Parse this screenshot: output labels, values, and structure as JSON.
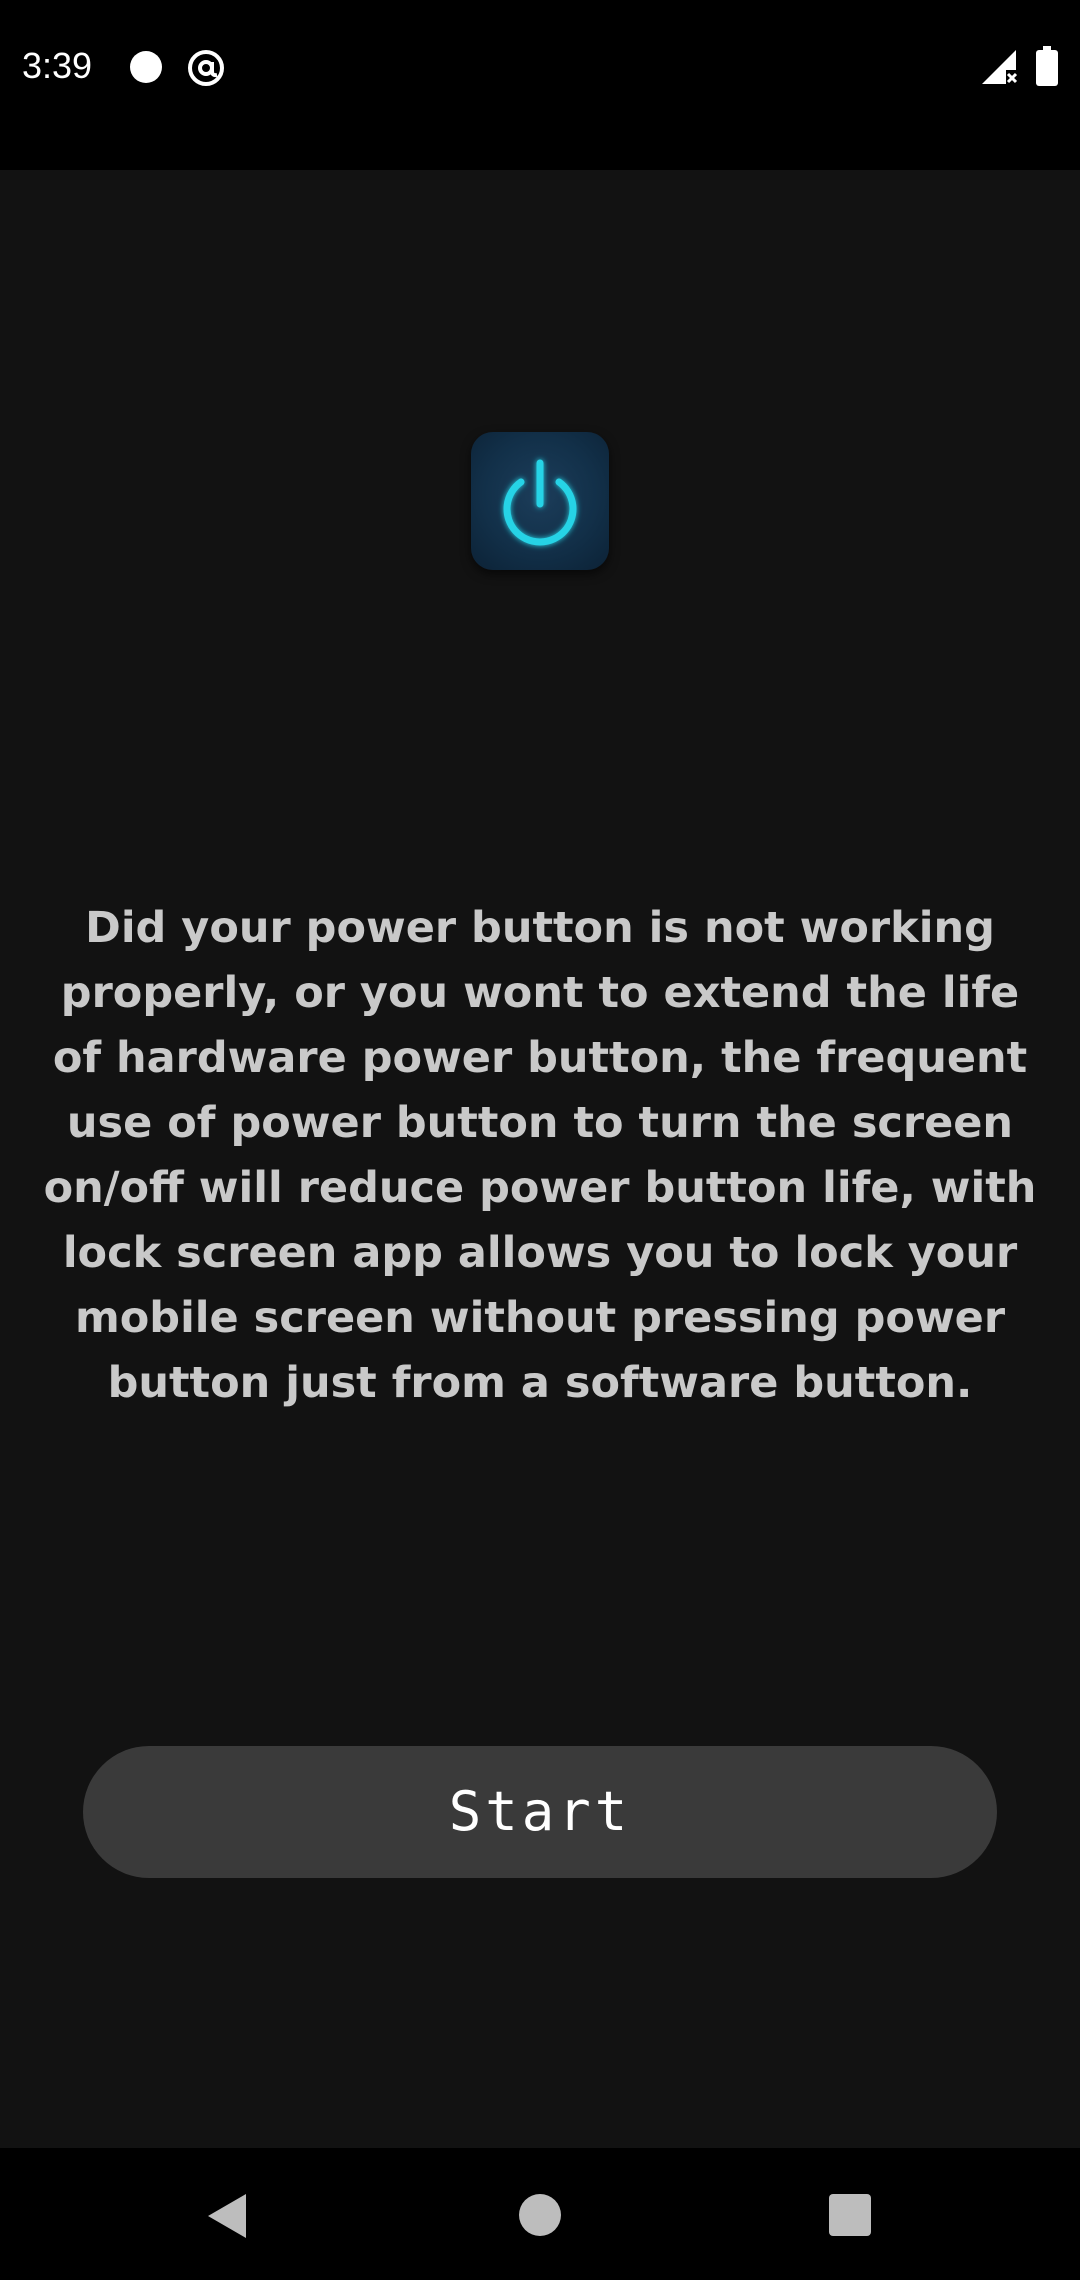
{
  "status_bar": {
    "time": "3:39",
    "icons": [
      "notification-dot-icon",
      "at-sign-icon",
      "signal-icon",
      "battery-icon"
    ]
  },
  "app": {
    "logo_icon": "power-icon",
    "logo_color": "#27d3e6",
    "description": "Did your power button is not working properly, or you wont to extend the life of hardware power button, the frequent use of power button to turn the screen on/off will reduce power button life, with lock screen app allows you to lock your mobile screen without pressing power button just from a software button.",
    "start_label": "Start"
  },
  "nav_bar": {
    "icons": [
      "back-icon",
      "home-icon",
      "recents-icon"
    ]
  },
  "colors": {
    "background": "#121212",
    "text": "#c9c9c9",
    "button": "#3a3a3a",
    "accent": "#27d3e6"
  }
}
